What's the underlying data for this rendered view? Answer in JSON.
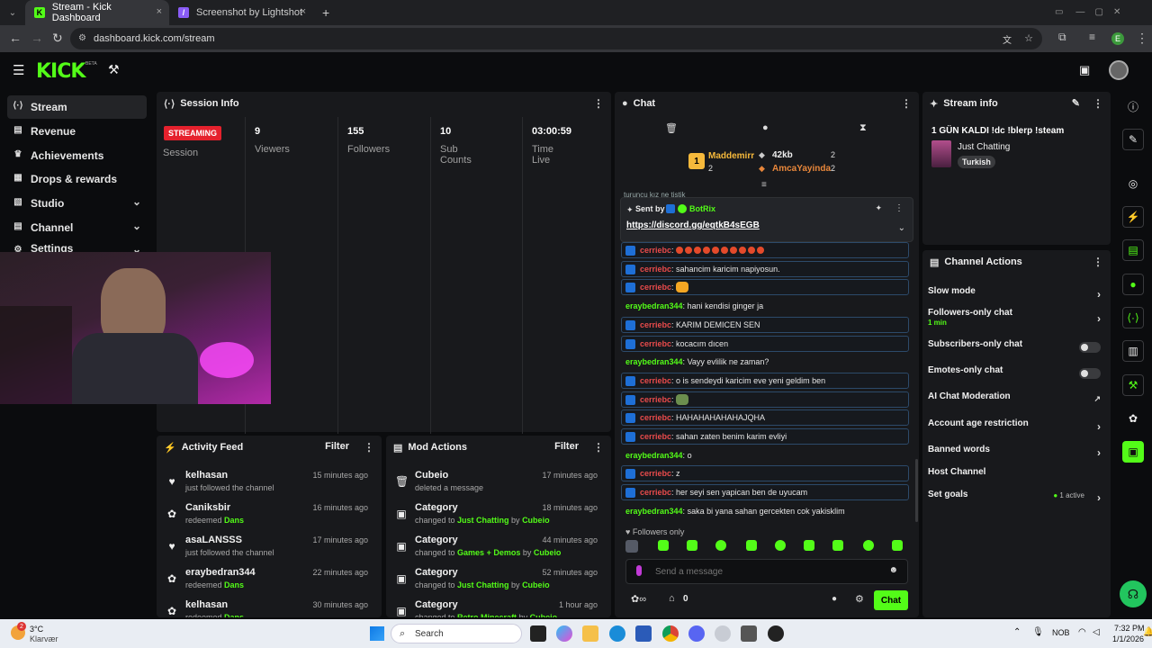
{
  "browser": {
    "tabs": [
      {
        "label": "Stream - Kick Dashboard",
        "close": "×"
      },
      {
        "label": "Screenshot by Lightshot",
        "close": "×"
      }
    ],
    "new_tab": "+",
    "url": "dashboard.kick.com/stream",
    "profile_initial": "E"
  },
  "header": {
    "logo": "KICK",
    "beta": "BETA"
  },
  "sidebar": {
    "items": [
      {
        "label": "Stream",
        "icon": "signal-icon"
      },
      {
        "label": "Revenue",
        "icon": "revenue-icon"
      },
      {
        "label": "Achievements",
        "icon": "trophy-icon"
      },
      {
        "label": "Drops & rewards",
        "icon": "gift-icon"
      },
      {
        "label": "Studio",
        "icon": "studio-icon"
      },
      {
        "label": "Channel",
        "icon": "channel-icon"
      },
      {
        "label": "Settings",
        "icon": "gear-icon"
      }
    ]
  },
  "session": {
    "title": "Session Info",
    "status_badge": "STREAMING",
    "status_label": "Session",
    "stats": [
      {
        "value": "9",
        "label": "Viewers"
      },
      {
        "value": "155",
        "label": "Followers"
      },
      {
        "value": "10",
        "label": "Sub Counts"
      },
      {
        "value": "03:00:59",
        "label": "Time Live"
      }
    ]
  },
  "activity": {
    "title": "Activity Feed",
    "filter": "Filter",
    "items": [
      {
        "name": "kelhasan",
        "sub": "just followed the channel",
        "hl": "",
        "time": "15 minutes ago",
        "icon": "heart-icon"
      },
      {
        "name": "Caniksbir",
        "sub": "redeemed ",
        "hl": "Dans",
        "time": "16 minutes ago",
        "icon": "points-icon"
      },
      {
        "name": "asaLANSSS",
        "sub": "just followed the channel",
        "hl": "",
        "time": "17 minutes ago",
        "icon": "heart-icon"
      },
      {
        "name": "eraybedran344",
        "sub": "redeemed ",
        "hl": "Dans",
        "time": "22 minutes ago",
        "icon": "points-icon"
      },
      {
        "name": "kelhasan",
        "sub": "redeemed ",
        "hl": "Dans",
        "time": "30 minutes ago",
        "icon": "points-icon"
      }
    ]
  },
  "mod": {
    "title": "Mod Actions",
    "filter": "Filter",
    "items": [
      {
        "name": "Cubeio",
        "pre": "deleted a message",
        "cat": "",
        "by": "",
        "user": "",
        "time": "17 minutes ago",
        "icon": "trash-icon"
      },
      {
        "name": "Category",
        "pre": "changed to ",
        "cat": "Just Chatting",
        "by": " by ",
        "user": "Cubeio",
        "time": "18 minutes ago",
        "icon": "category-icon"
      },
      {
        "name": "Category",
        "pre": "changed to ",
        "cat": "Games + Demos",
        "by": " by ",
        "user": "Cubeio",
        "time": "44 minutes ago",
        "icon": "category-icon"
      },
      {
        "name": "Category",
        "pre": "changed to ",
        "cat": "Just Chatting",
        "by": " by ",
        "user": "Cubeio",
        "time": "52 minutes ago",
        "icon": "category-icon"
      },
      {
        "name": "Category",
        "pre": "changed to ",
        "cat": "Retro Minecraft",
        "by": " by ",
        "user": "Cubeio",
        "time": "1 hour ago",
        "icon": "category-icon"
      }
    ]
  },
  "chat": {
    "title": "Chat",
    "leaderboard": [
      {
        "rank": "1",
        "name": "Maddemirr",
        "count": "2"
      },
      {
        "name": "42kb",
        "count": "2"
      },
      {
        "name": "AmcaYayinda",
        "count": "2"
      }
    ],
    "pinned": {
      "sent_by": "Sent by",
      "sender": "BotRix",
      "link": "https://discord.gg/eqtkB4sEGB",
      "partial_line": "turuncu kız ne tistik"
    },
    "messages": [
      {
        "user": "cerriebc",
        "color": "r",
        "text": "",
        "boxed": true,
        "emotes": 10
      },
      {
        "user": "cerriebc",
        "color": "r",
        "text": "sahancim karicim napiyosun.",
        "boxed": true
      },
      {
        "user": "cerriebc",
        "color": "r",
        "text": "",
        "boxed": true,
        "emotes": 1
      },
      {
        "user": "eraybedran344",
        "color": "g",
        "text": "hani kendisi ginger ja",
        "boxed": false
      },
      {
        "user": "cerriebc",
        "color": "r",
        "text": "KARIM DEMICEN SEN",
        "boxed": true
      },
      {
        "user": "cerriebc",
        "color": "r",
        "text": "kocacım dıcen",
        "boxed": true
      },
      {
        "user": "eraybedran344",
        "color": "g",
        "text": "Vayy evlilik ne zaman?",
        "boxed": false
      },
      {
        "user": "cerriebc",
        "color": "r",
        "text": "o is sendeydi karicim eve yeni geldim ben",
        "boxed": true
      },
      {
        "user": "cerriebc",
        "color": "r",
        "text": "",
        "boxed": true,
        "emotes": 1
      },
      {
        "user": "cerriebc",
        "color": "r",
        "text": "HAHAHAHAHAHAJQHA",
        "boxed": true
      },
      {
        "user": "cerriebc",
        "color": "r",
        "text": "sahan zaten benim karim evliyi",
        "boxed": true
      },
      {
        "user": "eraybedran344",
        "color": "g",
        "text": "o",
        "boxed": false
      },
      {
        "user": "cerriebc",
        "color": "r",
        "text": "z",
        "boxed": true
      },
      {
        "user": "cerriebc",
        "color": "r",
        "text": "her seyi sen yapican ben de uyucam",
        "boxed": true
      },
      {
        "user": "eraybedran344",
        "color": "g",
        "text": "saka bi yana sahan gercekten cok yakisklim",
        "boxed": false
      }
    ],
    "followers_only": "Followers only",
    "placeholder": "Send a message",
    "points": "0",
    "send": "Chat"
  },
  "stream_info": {
    "title": "Stream info",
    "stream_title": "1 GÜN KALDI !dc !blerp !steam",
    "category": "Just Chatting",
    "tag": "Turkish"
  },
  "channel_actions": {
    "title": "Channel Actions",
    "slow_mode": "Slow mode",
    "followers_only": "Followers-only chat",
    "followers_only_sub": "1 min",
    "subscribers_only": "Subscribers-only chat",
    "emotes_only": "Emotes-only chat",
    "ai_mod": "AI Chat Moderation",
    "account_age": "Account age restriction",
    "banned_words": "Banned words",
    "host": "Host Channel",
    "goals": "Set goals",
    "goals_status": "1 active"
  },
  "taskbar": {
    "weather_temp": "3°C",
    "weather_desc": "Klarvær",
    "weather_badge": "2",
    "search": "Search",
    "lang": "NOB",
    "time": "7:32 PM",
    "date": "1/1/2026"
  },
  "colors": {
    "accent": "#53fc18",
    "live": "#e5212d",
    "panel": "#18191c",
    "bg": "#0b0c0e"
  }
}
